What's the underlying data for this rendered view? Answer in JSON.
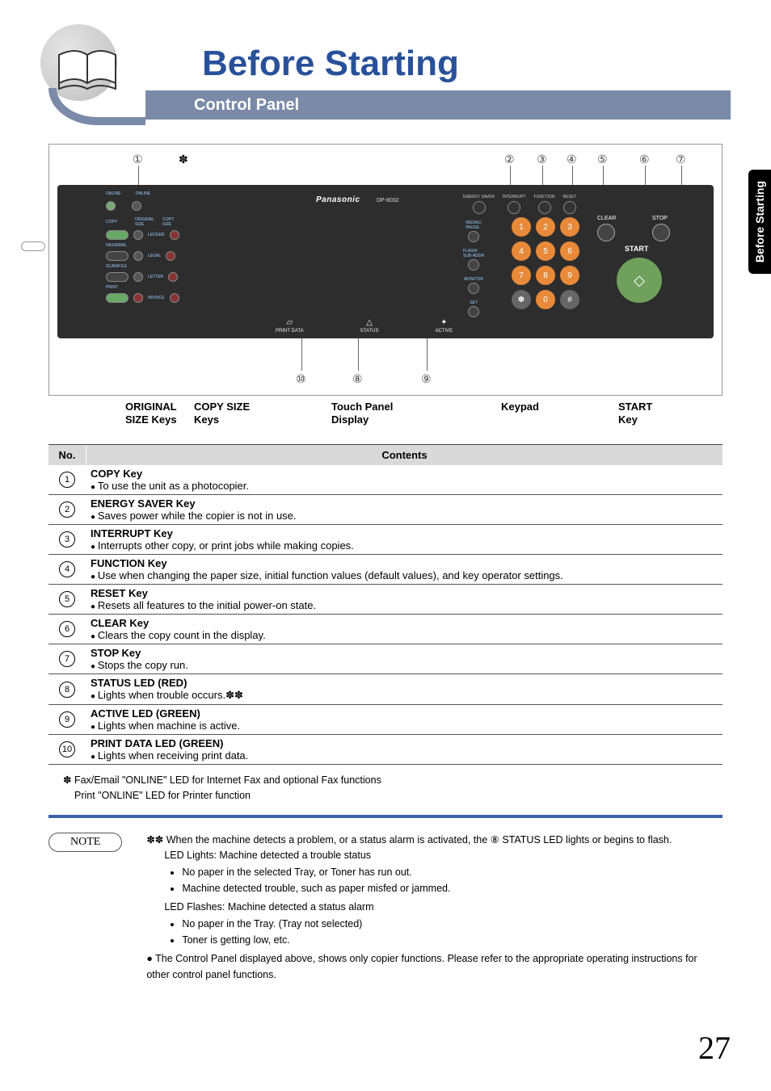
{
  "sideTab": "Before Starting",
  "title": "Before Starting",
  "subtitle": "Control Panel",
  "pageNumber": "27",
  "panel": {
    "brand": "Panasonic",
    "model": "DP-8032",
    "topCallouts": {
      "c1": "①",
      "c2": "②",
      "c3": "③",
      "c4": "④",
      "c5": "⑤",
      "c6": "⑥",
      "c7": "⑦",
      "ast": "✽"
    },
    "botCallouts": {
      "c8": "⑧",
      "c9": "⑨",
      "c10": "⑩"
    },
    "leds": {
      "print": "PRINT DATA",
      "status": "STATUS",
      "active": "ACTIVE"
    },
    "topkeys": {
      "es": "ENERGY SAVER",
      "int": "INTERRUPT",
      "fn": "FUNCTION",
      "rs": "RESET"
    },
    "sidekeys": {
      "pause": "REDIAL/\nPAUSE",
      "flash": "FLASH/\nSUB-ADDR",
      "mon": "MONITOR",
      "set": "SET"
    },
    "right": {
      "clear": "CLEAR",
      "stop": "STOP",
      "start": "START"
    },
    "leftcluster": {
      "copy": "COPY",
      "os": "ORIGINAL\nSIZE",
      "cs": "COPY\nSIZE",
      "ledger": "LEDGER",
      "legal": "LEGAL",
      "letter": "LETTER",
      "invoice": "INVOICE",
      "fax": "FAX/EMAIL",
      "scan": "SCAN/FILE",
      "print": "PRINT",
      "online1": "ONLINE",
      "online2": "ONLINE"
    }
  },
  "labels": {
    "l1": "ORIGINAL\nSIZE Keys",
    "l2": "COPY SIZE\nKeys",
    "l3": "Touch Panel\nDisplay",
    "l4": "Keypad",
    "l5": "START\nKey"
  },
  "tableHead": {
    "no": "No.",
    "contents": "Contents"
  },
  "rows": [
    {
      "n": "①",
      "t": "COPY Key",
      "d": "To use the unit as a photocopier."
    },
    {
      "n": "②",
      "t": "ENERGY SAVER Key",
      "d": "Saves power while the copier is not in use."
    },
    {
      "n": "③",
      "t": "INTERRUPT Key",
      "d": "Interrupts other copy, or print jobs while making copies."
    },
    {
      "n": "④",
      "t": "FUNCTION Key",
      "d": "Use when changing the paper size, initial function values (default values), and key operator settings."
    },
    {
      "n": "⑤",
      "t": "RESET Key",
      "d": "Resets all features to the initial power-on state."
    },
    {
      "n": "⑥",
      "t": "CLEAR Key",
      "d": "Clears the copy count in the display."
    },
    {
      "n": "⑦",
      "t": "STOP Key",
      "d": "Stops the copy run."
    },
    {
      "n": "⑧",
      "t": "STATUS LED (RED)",
      "d": "Lights when trouble occurs.✽✽"
    },
    {
      "n": "⑨",
      "t": "ACTIVE LED (GREEN)",
      "d": "Lights when machine is active."
    },
    {
      "n": "⑩",
      "t": "PRINT DATA LED (GREEN)",
      "d": "Lights when receiving print data."
    }
  ],
  "starNote": {
    "l1": "Fax/Email \"ONLINE\" LED for Internet Fax and optional Fax functions",
    "l2": "Print \"ONLINE\" LED for Printer function"
  },
  "noteLabel": "NOTE",
  "note": {
    "a": "When the machine detects a problem, or a status alarm is activated, the ⑧ STATUS LED lights or begins to flash.",
    "b": "LED Lights: Machine detected a trouble status",
    "b1": "No paper in the selected Tray, or Toner has run out.",
    "b2": "Machine detected trouble, such as paper misfed or jammed.",
    "c": "LED Flashes: Machine detected a status alarm",
    "c1": "No paper in the Tray. (Tray not selected)",
    "c2": "Toner is getting low, etc.",
    "d": "The Control Panel displayed above, shows only copier functions. Please refer to the appropriate operating instructions for other control panel functions."
  }
}
